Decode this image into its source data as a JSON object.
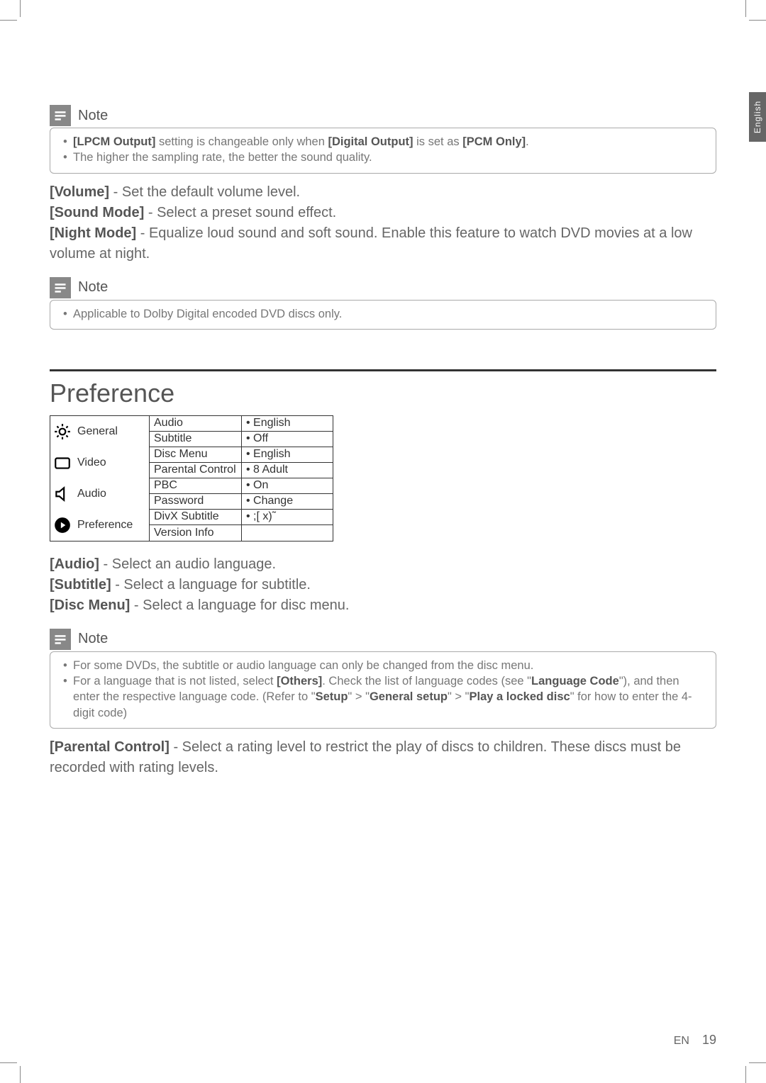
{
  "sideTab": "English",
  "note1": {
    "title": "Note",
    "items": [
      "<b>[LPCM Output]</b> setting is changeable only when <b>[Digital Output]</b> is set as <b>[PCM Only]</b>.",
      "The higher the sampling rate, the better the sound quality."
    ]
  },
  "para1": "<b>[Volume]</b> - Set the default volume level.<br><b>[Sound Mode]</b> - Select a preset sound effect.<br><b>[Night Mode]</b> - Equalize loud sound and soft sound. Enable this feature to watch DVD movies at a low volume at night.",
  "note2": {
    "title": "Note",
    "items": [
      "Applicable to Dolby Digital encoded DVD discs only."
    ]
  },
  "sectionTitle": "Preference",
  "menu": {
    "left": [
      {
        "label": "General"
      },
      {
        "label": "Video"
      },
      {
        "label": "Audio"
      },
      {
        "label": "Preference"
      }
    ],
    "rows": [
      {
        "key": "Audio",
        "val": "English"
      },
      {
        "key": "Subtitle",
        "val": "Off"
      },
      {
        "key": "Disc Menu",
        "val": "English"
      },
      {
        "key": "Parental Control",
        "val": "8 Adult"
      },
      {
        "key": "PBC",
        "val": "On"
      },
      {
        "key": "Password",
        "val": "Change"
      },
      {
        "key": "DivX Subtitle",
        "val": ";[ x)˜"
      },
      {
        "key": "Version Info",
        "val": ""
      }
    ]
  },
  "para2": "<b>[Audio]</b> - Select an audio language.<br><b>[Subtitle]</b> - Select a language for subtitle.<br><b>[Disc Menu]</b> - Select a language for disc menu.",
  "note3": {
    "title": "Note",
    "items": [
      "For some DVDs, the subtitle or audio language can only be changed from the disc menu.",
      "For a language that is not listed, select <b>[Others]</b>. Check the list of language codes (see \"<b>Language Code</b>\"), and then enter the respective language code. (Refer to \"<b>Setup</b>\" &gt; \"<b>General setup</b>\" &gt; \"<b>Play a locked disc</b>\" for how to enter the 4-digit code)"
    ]
  },
  "para3": "<b>[Parental Control]</b> - Select a rating level to restrict the play of discs to children. These discs must be recorded with rating levels.",
  "footer": {
    "lang": "EN",
    "page": "19"
  }
}
